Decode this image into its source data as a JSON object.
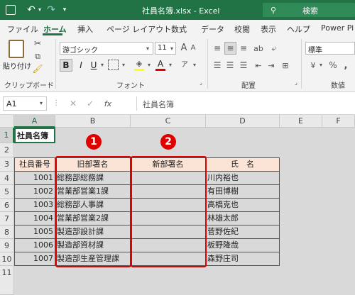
{
  "titlebar": {
    "title": "社員名簿.xlsx  -  Excel",
    "search_placeholder": "検索",
    "undo_icon": "undo-icon",
    "redo_icon": "redo-icon"
  },
  "menu": {
    "tabs": [
      "ファイル",
      "ホーム",
      "挿入",
      "ページ レイアウト",
      "数式",
      "データ",
      "校閲",
      "表示",
      "ヘルプ",
      "Power Pi"
    ],
    "active": "ホーム"
  },
  "ribbon": {
    "clipboard": {
      "paste": "貼り付け",
      "group": "クリップボード"
    },
    "font": {
      "name": "游ゴシック",
      "size": "11",
      "bold": "B",
      "italic": "I",
      "underline": "U",
      "group": "フォント"
    },
    "alignment": {
      "group": "配置"
    },
    "number": {
      "format": "標準",
      "percent": "%",
      "comma": ",",
      "group": "数値"
    }
  },
  "formula_bar": {
    "name_box": "A1",
    "fx": "fx",
    "content": "社員名簿"
  },
  "sheet": {
    "columns": [
      "A",
      "B",
      "C",
      "D",
      "E",
      "F"
    ],
    "rows": [
      "1",
      "2",
      "3",
      "4",
      "5",
      "6",
      "7",
      "8",
      "9",
      "10",
      "11"
    ],
    "title": "社員名簿",
    "headers": [
      "社員番号",
      "旧部署名",
      "新部署名",
      "氏　名"
    ],
    "data": [
      [
        "1001",
        "総務部総務課",
        "",
        "川内裕也"
      ],
      [
        "1002",
        "営業部営業1課",
        "",
        "有田博樹"
      ],
      [
        "1003",
        "総務部人事課",
        "",
        "高橋克也"
      ],
      [
        "1004",
        "営業部営業2課",
        "",
        "林雄太郎"
      ],
      [
        "1005",
        "製造部設計課",
        "",
        "菅野佐紀"
      ],
      [
        "1006",
        "製造部資材課",
        "",
        "板野隆哉"
      ],
      [
        "1007",
        "製造部生産管理課",
        "",
        "森野庄司"
      ]
    ]
  },
  "annotations": {
    "badge1": "1",
    "badge2": "2",
    "highlight_color": "#e00000"
  },
  "colors": {
    "excel_green": "#217346",
    "header_fill": "#fbe4d5"
  }
}
